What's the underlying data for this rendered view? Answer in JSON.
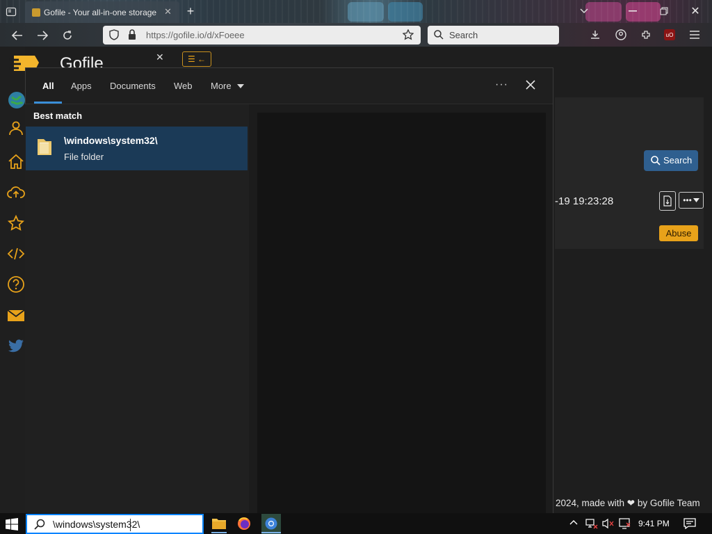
{
  "browser": {
    "tab_title": "Gofile - Your all-in-one storage",
    "url": "https://gofile.io/d/xFoeee",
    "search_placeholder": "Search"
  },
  "site": {
    "logo_text": "Gofile",
    "search_button": "Search",
    "file_date": "-19 19:23:28",
    "abuse_button": "Abuse",
    "footer": "2024, made with ❤ by Gofile Team"
  },
  "search_panel": {
    "tabs": [
      "All",
      "Apps",
      "Documents",
      "Web",
      "More"
    ],
    "section_label": "Best match",
    "result": {
      "title": "\\windows\\system32\\",
      "subtitle": "File folder"
    }
  },
  "taskbar": {
    "query": "\\windows\\system32\\",
    "time": "9:41 PM"
  },
  "colors": {
    "accent_blue": "#0a84ff",
    "result_highlight": "#1b3a57",
    "gofile_orange": "#e8a21a",
    "nav_icon": "#e8a21a"
  },
  "icons": [
    "sidebar-icon",
    "back-icon",
    "forward-icon",
    "reload-icon",
    "shield-icon",
    "lock-icon",
    "star-icon",
    "search-icon",
    "download-icon",
    "account-icon",
    "extensions-icon",
    "ublock-icon",
    "menu-icon",
    "minimize-icon",
    "restore-icon",
    "close-icon",
    "globe-icon",
    "user-icon",
    "home-icon",
    "upload-icon",
    "favorite-icon",
    "code-icon",
    "help-icon",
    "mail-icon",
    "twitter-icon",
    "folder-icon",
    "windows-icon",
    "file-explorer-icon",
    "firefox-icon",
    "chrome-icon",
    "chevron-up-icon",
    "network-icon",
    "volume-muted-icon",
    "notifications-icon"
  ]
}
